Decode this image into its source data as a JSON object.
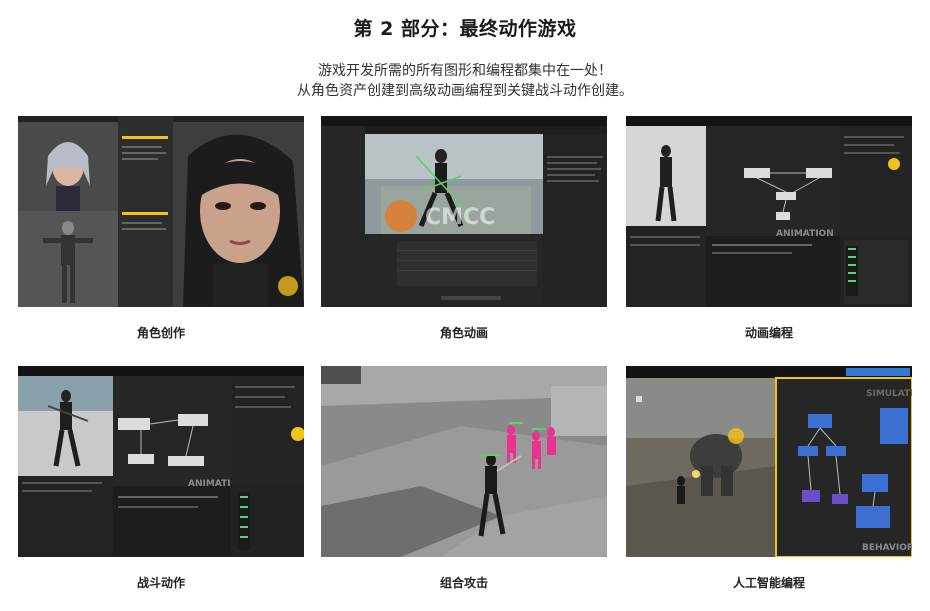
{
  "header": {
    "title": "第 2 部分：最终动作游戏",
    "subtitle_line1": "游戏开发所需的所有图形和编程都集中在一处！",
    "subtitle_line2": "从角色资产创建到高级动画编程到关键战斗动作创建。"
  },
  "cards": [
    {
      "caption": "角色创作",
      "icon": "character-creation-screenshot"
    },
    {
      "caption": "角色动画",
      "icon": "character-animation-screenshot",
      "watermark": "CMCC"
    },
    {
      "caption": "动画编程",
      "icon": "animation-programming-screenshot",
      "overlay": "ANIMATION"
    },
    {
      "caption": "战斗动作",
      "icon": "combat-action-screenshot",
      "overlay": "ANIMATION"
    },
    {
      "caption": "组合攻击",
      "icon": "combo-attack-screenshot"
    },
    {
      "caption": "人工智能编程",
      "icon": "ai-programming-screenshot",
      "overlay": "BEHAVIOR",
      "overlay_top": "SIMULATION"
    }
  ],
  "colors": {
    "editor_bg": "#2b2b2b",
    "panel_dark": "#1e1e1e",
    "accent_yellow": "#f0c419",
    "accent_blue": "#2f7bd6",
    "node_blue": "#3b6fd1",
    "node_purple": "#6a4fc9"
  }
}
